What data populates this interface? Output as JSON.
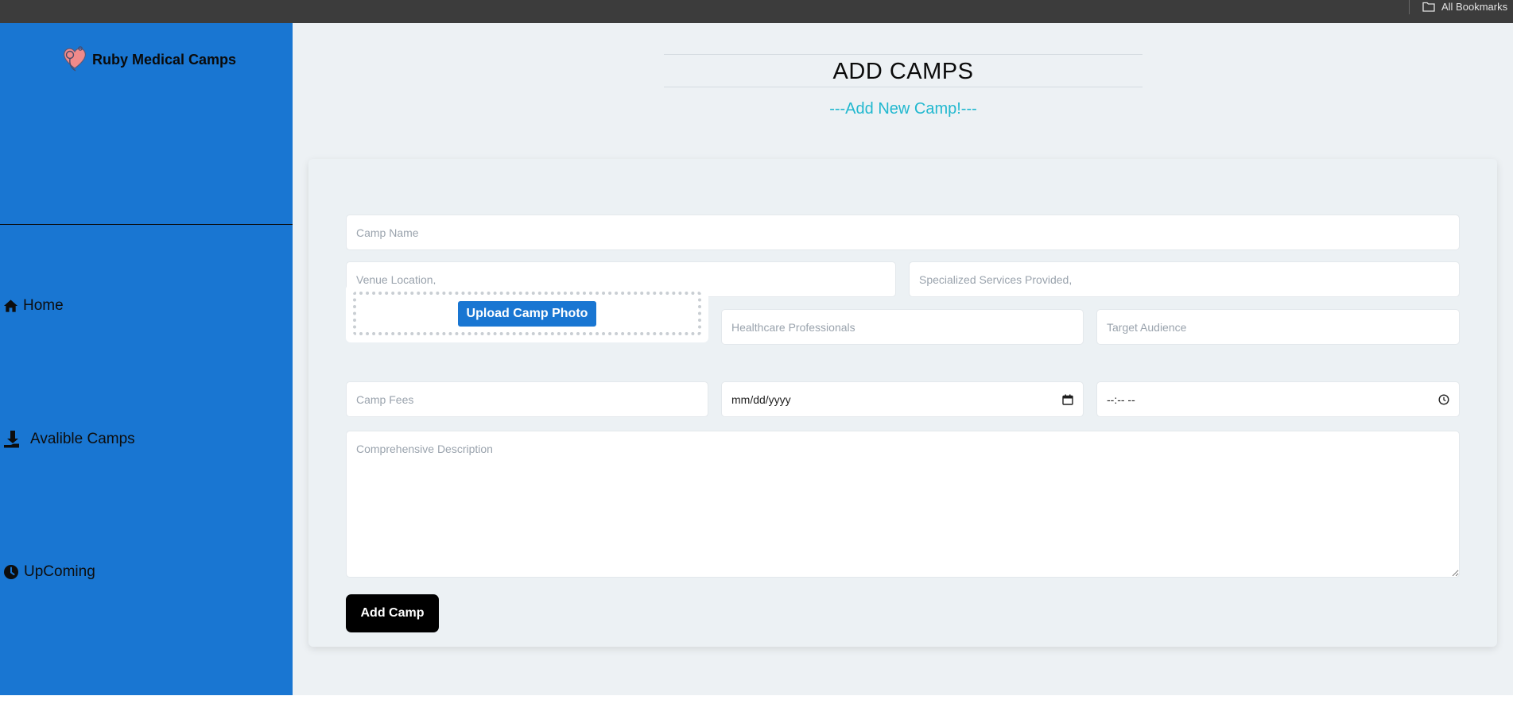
{
  "browser": {
    "bookmarks_label": "All Bookmarks"
  },
  "sidebar": {
    "brand": "Ruby Medical Camps",
    "items": [
      {
        "label": "Home",
        "icon": "home-icon"
      },
      {
        "label": "Avalible Camps",
        "icon": "hand-holding-icon"
      },
      {
        "label": "UpComing",
        "icon": "clock-icon"
      }
    ]
  },
  "main": {
    "title": "ADD CAMPS",
    "subtitle": "---Add New Camp!---"
  },
  "form": {
    "camp_name_placeholder": "Camp Name",
    "venue_placeholder": "Venue Location,",
    "services_placeholder": "Specialized Services Provided,",
    "upload_label": "Upload Camp Photo",
    "professionals_placeholder": "Healthcare Professionals",
    "audience_placeholder": "Target Audience",
    "fees_placeholder": "Camp Fees",
    "date_value": "mm/dd/yyyy",
    "time_value": "--:-- --",
    "description_placeholder": "Comprehensive Description",
    "submit_label": "Add Camp"
  },
  "colors": {
    "sidebar": "#1976d2",
    "accent_subtitle": "#21b8cf",
    "primary_button": "#000000",
    "upload_button": "#1976d2"
  }
}
